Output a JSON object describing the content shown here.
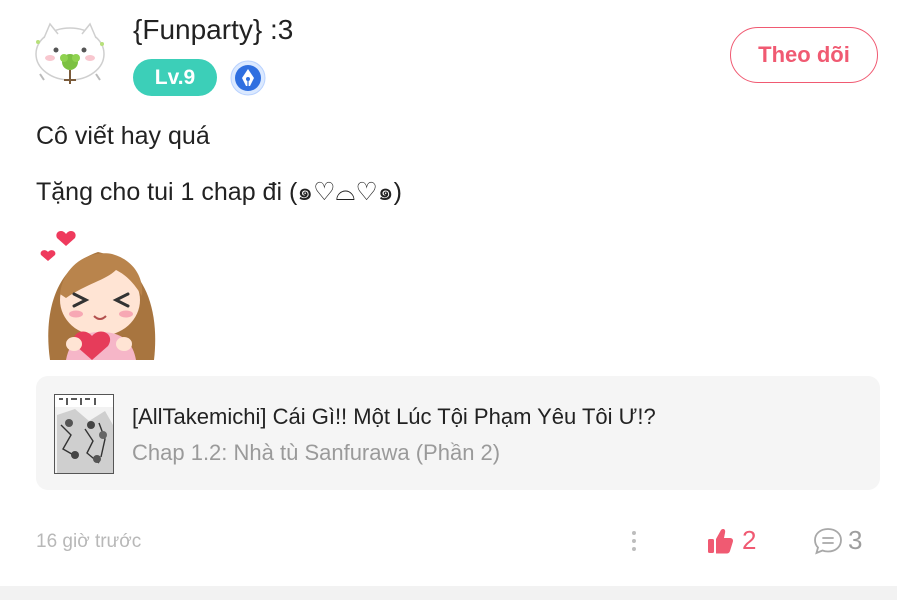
{
  "user": {
    "name": "{Funparty} :3",
    "level": "Lv.9",
    "level_color": "#3ccfb8"
  },
  "follow_button": {
    "label": "Theo dõi",
    "color": "#f05a72"
  },
  "comment": {
    "line1": "Cô viết hay quá",
    "line2": "Tặng cho tui 1 chap đi (๑♡⌓♡๑)"
  },
  "chapter_card": {
    "title": "[AllTakemichi] Cái Gì!! Một Lúc Tội Phạm Yêu Tôi Ư!?",
    "subtitle": "Chap 1.2: Nhà tù Sanfurawa (Phần 2)"
  },
  "footer": {
    "time": "16 giờ trước",
    "like_count": "2",
    "reply_count": "3"
  },
  "icons": {
    "avatar": "cat-avatar-icon",
    "badge": "pen-nib-badge-icon",
    "like": "thumbs-up-icon",
    "reply": "speech-bubble-icon",
    "more": "vertical-dots-icon"
  }
}
